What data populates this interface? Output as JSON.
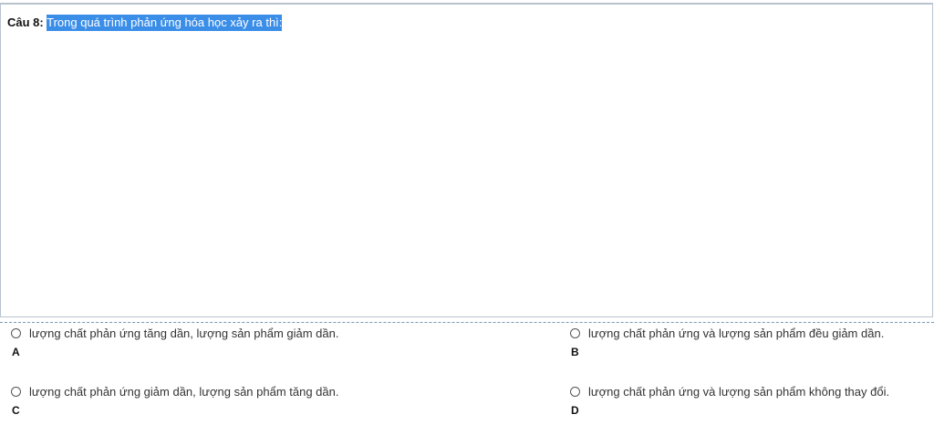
{
  "question": {
    "label": "Câu 8:",
    "text": "Trong quá trình phản ứng hóa học xảy ra thì:"
  },
  "options": [
    {
      "letter": "A",
      "text": "lượng chất phản ứng tăng dần, lượng sản phẩm giảm dần."
    },
    {
      "letter": "B",
      "text": "lượng chất phản ứng và lượng sản phẩm đều giảm dần."
    },
    {
      "letter": "C",
      "text": "lượng chất phản ứng giảm dần, lượng sản phẩm tăng dần."
    },
    {
      "letter": "D",
      "text": "lượng chất phản ứng và lượng sản phẩm không thay đổi."
    }
  ],
  "colors": {
    "selection_highlight": "#3b8ee8",
    "border": "#b9c3cf"
  }
}
